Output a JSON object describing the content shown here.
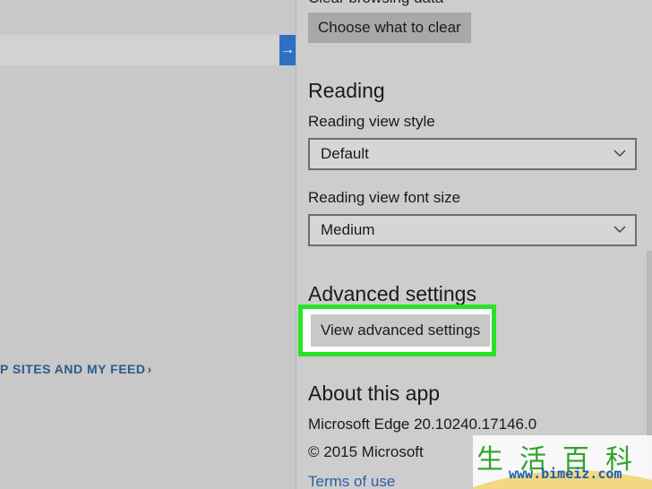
{
  "browser": {
    "feed_link": "P SITES AND MY FEED",
    "feed_link_chevron": "›",
    "address_button_glyph": "→"
  },
  "settings": {
    "clear_browsing_data_label": "Clear browsing data",
    "choose_what_to_clear_button": "Choose what to clear",
    "reading": {
      "title": "Reading",
      "view_style_label": "Reading view style",
      "view_style_value": "Default",
      "font_size_label": "Reading view font size",
      "font_size_value": "Medium"
    },
    "advanced": {
      "title": "Advanced settings",
      "button": "View advanced settings",
      "highlight_color": "#27e327"
    },
    "about": {
      "title": "About this app",
      "version": "Microsoft Edge 20.10240.17146.0",
      "copyright": "© 2015 Microsoft",
      "terms_link": "Terms of use"
    }
  },
  "watermark": {
    "chars": "生活百科",
    "url": "www.bimeiz.com"
  },
  "colors": {
    "panel_bg": "#cdcdcd",
    "link": "#2a5fa8",
    "accent_blue": "#2f6fc1"
  }
}
